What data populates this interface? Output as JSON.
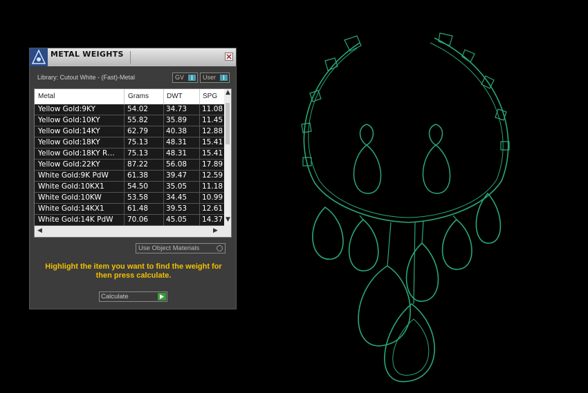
{
  "panel": {
    "title": "METAL WEIGHTS",
    "library_label": "Library: Cutout White - (Fast)-Metal",
    "toggles": [
      {
        "label": "GV",
        "icon": "toggle-switch-icon"
      },
      {
        "label": "User",
        "icon": "toggle-switch-icon"
      }
    ],
    "columns": [
      "Metal",
      "Grams",
      "DWT",
      "SPG"
    ],
    "rows": [
      {
        "metal": "Yellow Gold:9KY",
        "grams": "54.02",
        "dwt": "34.73",
        "spg": "11.08"
      },
      {
        "metal": "Yellow Gold:10KY",
        "grams": "55.82",
        "dwt": "35.89",
        "spg": "11.45"
      },
      {
        "metal": "Yellow Gold:14KY",
        "grams": "62.79",
        "dwt": "40.38",
        "spg": "12.88"
      },
      {
        "metal": "Yellow Gold:18KY",
        "grams": "75.13",
        "dwt": "48.31",
        "spg": "15.41"
      },
      {
        "metal": "Yellow Gold:18KY R…",
        "grams": "75.13",
        "dwt": "48.31",
        "spg": "15.41"
      },
      {
        "metal": "Yellow Gold:22KY",
        "grams": "87.22",
        "dwt": "56.08",
        "spg": "17.89"
      },
      {
        "metal": "White Gold:9K PdW",
        "grams": "61.38",
        "dwt": "39.47",
        "spg": "12.59"
      },
      {
        "metal": "White Gold:10KX1",
        "grams": "54.50",
        "dwt": "35.05",
        "spg": "11.18"
      },
      {
        "metal": "White Gold:10KW",
        "grams": "53.58",
        "dwt": "34.45",
        "spg": "10.99"
      },
      {
        "metal": "White Gold:14KX1",
        "grams": "61.48",
        "dwt": "39.53",
        "spg": "12.61"
      },
      {
        "metal": "White Gold:14K PdW",
        "grams": "70.06",
        "dwt": "45.05",
        "spg": "14.37"
      }
    ],
    "use_object_materials": "Use Object Materials",
    "instruction": "Highlight the item you want to find the weight for then press calculate.",
    "calculate_label": "Calculate"
  },
  "colors": {
    "panel_bg": "#3c3c3c",
    "instruction_text": "#f2c000",
    "jewelry_wire": "#2aa877",
    "toggle_knob": "#4a9bb0",
    "calculate_go": "#3a9a3a"
  }
}
